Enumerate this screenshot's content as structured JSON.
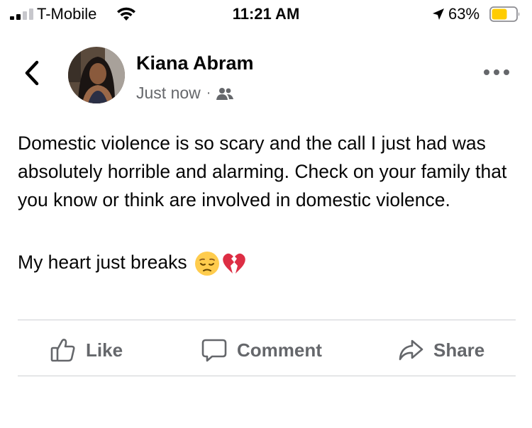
{
  "status_bar": {
    "carrier": "T-Mobile",
    "time": "11:21 AM",
    "battery_percent": "63%",
    "battery_level": 0.63,
    "signal_bars_active": 2,
    "signal_bars_total": 4
  },
  "post": {
    "author": "Kiana Abram",
    "timestamp": "Just now",
    "meta_separator": "·",
    "audience_icon": "friends-icon",
    "paragraph_1": "Domestic violence is so scary and the call I just had was absolutely horrible and alarming. Check on your family that you know or think are involved in domestic violence.",
    "paragraph_2": "My heart just breaks",
    "emojis": [
      "pensive-face",
      "broken-heart"
    ]
  },
  "actions": {
    "like": "Like",
    "comment": "Comment",
    "share": "Share"
  },
  "colors": {
    "text": "#050505",
    "secondary_text": "#65676b",
    "divider": "#ced0d4",
    "battery": "#ffcc00"
  }
}
